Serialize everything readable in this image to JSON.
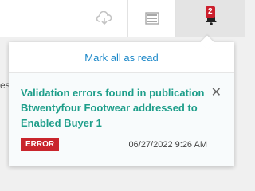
{
  "topbar": {
    "icons": [
      "cloud-download-icon",
      "list-icon",
      "bell-icon"
    ],
    "notification_count": "2"
  },
  "left_partial_text": "es",
  "notifications_panel": {
    "mark_all_label": "Mark all as read",
    "items": [
      {
        "message": "Validation errors found in publication Btwentyfour Footwear addressed to Enabled Buyer 1",
        "status": "ERROR",
        "timestamp": "06/27/2022 9:26 AM"
      }
    ]
  },
  "colors": {
    "accent_link": "#1a87c8",
    "message_teal": "#1e9e8a",
    "error_red": "#c9252c",
    "badge_red": "#cc1f2d"
  }
}
